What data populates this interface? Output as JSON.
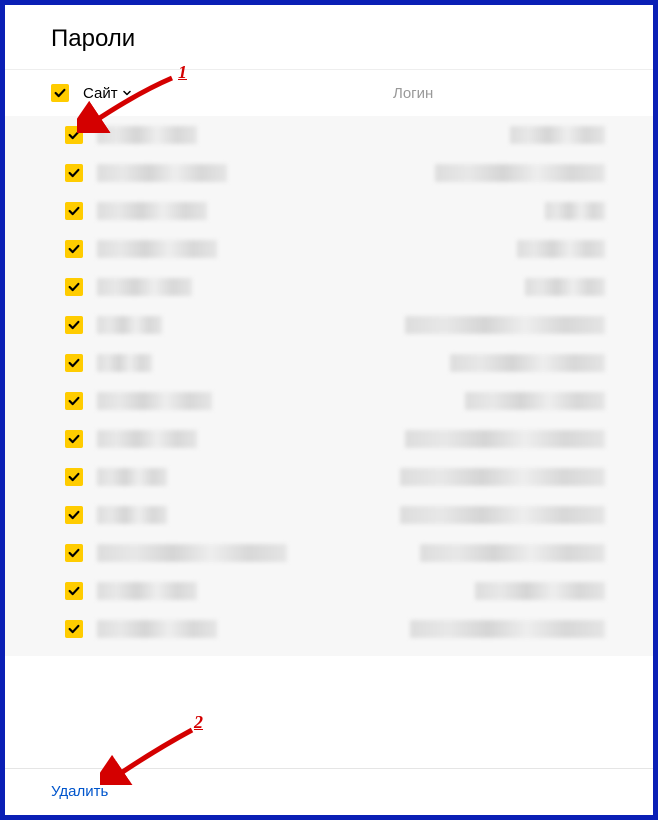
{
  "header": {
    "title": "Пароли"
  },
  "columns": {
    "site": "Сайт",
    "login": "Логин"
  },
  "annotations": {
    "one": "1",
    "two": "2"
  },
  "footer": {
    "delete": "Удалить"
  },
  "rows": [
    {
      "siteW": 100,
      "loginW": 95
    },
    {
      "siteW": 130,
      "loginW": 170
    },
    {
      "siteW": 110,
      "loginW": 60
    },
    {
      "siteW": 120,
      "loginW": 88
    },
    {
      "siteW": 95,
      "loginW": 80
    },
    {
      "siteW": 65,
      "loginW": 200
    },
    {
      "siteW": 55,
      "loginW": 155
    },
    {
      "siteW": 115,
      "loginW": 140
    },
    {
      "siteW": 100,
      "loginW": 200
    },
    {
      "siteW": 70,
      "loginW": 205
    },
    {
      "siteW": 70,
      "loginW": 205
    },
    {
      "siteW": 190,
      "loginW": 185
    },
    {
      "siteW": 100,
      "loginW": 130
    },
    {
      "siteW": 120,
      "loginW": 195
    }
  ]
}
